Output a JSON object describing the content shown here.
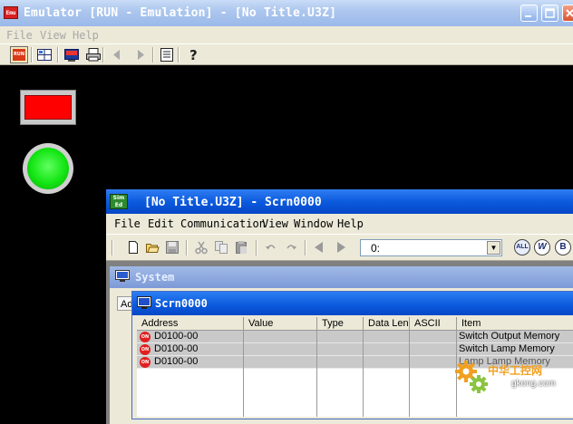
{
  "emulator": {
    "title": "Emulator [RUN - Emulation] - [No Title.U3Z]",
    "app_icon_text": "Emu",
    "menu": {
      "file": "File",
      "view": "View",
      "help": "Help"
    },
    "toolbar": {
      "run_label": "RUN"
    },
    "panel": {
      "switch_color": "#ff0000",
      "lamp_color": "#13e513"
    }
  },
  "editor": {
    "title": "[No Title.U3Z] - Scrn0000",
    "app_icon_text": "Sim Ed",
    "menu": {
      "file": "File",
      "edit": "Edit",
      "communication": "Communication",
      "view": "View",
      "window": "Window",
      "help": "Help"
    },
    "toolbar": {
      "screen_select_value": "0:",
      "all_label": "ALL",
      "w_label": "W",
      "b_label": "B"
    }
  },
  "system_window": {
    "title": "System",
    "col_peek": "Ad"
  },
  "screen_window": {
    "title": "Scrn0000",
    "columns": [
      "Address",
      "Value",
      "Type",
      "Data Len",
      "ASCII",
      "Item"
    ],
    "rows": [
      {
        "address": "D0100-00",
        "value": "",
        "type": "",
        "data_len": "",
        "ascii": "",
        "item": "Switch Output Memory"
      },
      {
        "address": "D0100-00",
        "value": "",
        "type": "",
        "data_len": "",
        "ascii": "",
        "item": "Switch Lamp Memory"
      },
      {
        "address": "D0100-00",
        "value": "",
        "type": "",
        "data_len": "",
        "ascii": "",
        "item": "Lamp Lamp Memory"
      }
    ],
    "row_icon_text": "ON"
  },
  "watermark": {
    "cn": "中华工控网",
    "url": "gkong.com"
  }
}
